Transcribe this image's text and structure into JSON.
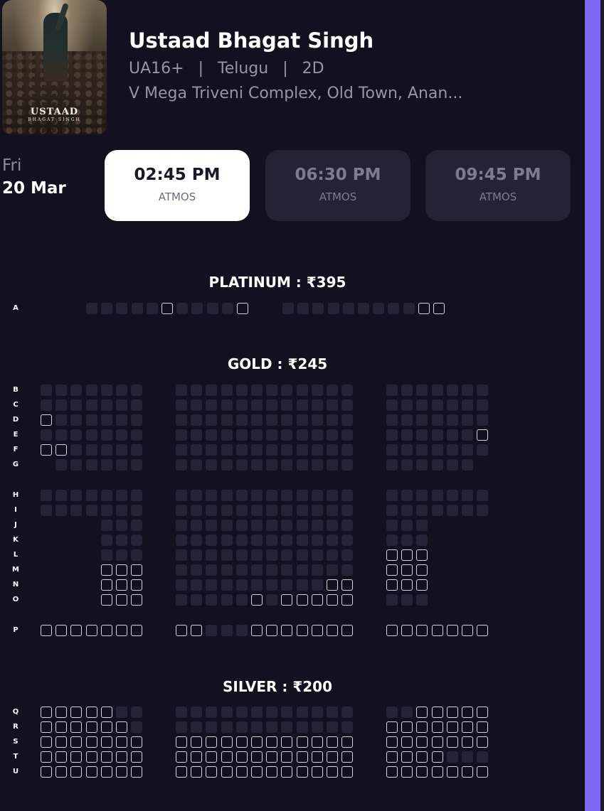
{
  "movie": {
    "title": "Ustaad Bhagat Singh",
    "certificate": "UA16+",
    "language": "Telugu",
    "format": "2D",
    "venue": "V Mega Triveni Complex, Old Town, Anan...",
    "poster_title": "USTAAD",
    "poster_subtitle": "BHAGAT SINGH"
  },
  "date": {
    "day": "Fri",
    "date": "20 Mar"
  },
  "showtimes": [
    {
      "time": "02:45 PM",
      "format": "ATMOS",
      "selected": true
    },
    {
      "time": "06:30 PM",
      "format": "ATMOS",
      "selected": false
    },
    {
      "time": "09:45 PM",
      "format": "ATMOS",
      "selected": false
    }
  ],
  "categories": [
    {
      "name": "PLATINUM : ₹395"
    },
    {
      "name": "GOLD : ₹245"
    },
    {
      "name": "SILVER : ₹200"
    }
  ],
  "seat_status_legend": {
    "A": "available",
    "S": "sold",
    "-": "no seat"
  },
  "seat_rows": [
    {
      "label": "A",
      "left": "",
      "mid": "SSSSSASSSSA",
      "right": "SSSSSSSSSAA",
      "layout": "platinum"
    },
    {
      "label": "B",
      "left": "SSSSSSS",
      "mid": "SSSSSSSSSSSS",
      "right": "SSSSSSS"
    },
    {
      "label": "C",
      "left": "SSSSSSS",
      "mid": "SSSSSSSSSSSS",
      "right": "SSSSSSS"
    },
    {
      "label": "D",
      "left": "ASSSSSS",
      "mid": "SSSSSSSSSSSS",
      "right": "SSSSSSS"
    },
    {
      "label": "E",
      "left": "SSSSSSS",
      "mid": "SSSSSSSSSSSS",
      "right": "SSSSSSA"
    },
    {
      "label": "F",
      "left": "AASSSSS",
      "mid": "SSSSSSSSSSSS",
      "right": "SSSSSSS"
    },
    {
      "label": "G",
      "left": "-SSSSSS",
      "mid": "SSSSSSSSSSSS",
      "right": "SSSSSS-"
    },
    {
      "label": "H",
      "left": "SSSSSSS",
      "mid": "SSSSSSSSSSSS",
      "right": "SSSSSSS"
    },
    {
      "label": "I",
      "left": "SSSSSSS",
      "mid": "SSSSSSSSSSSS",
      "right": "SSSSSSS"
    },
    {
      "label": "J",
      "left": "----SSS",
      "mid": "SSSSSSSSSSSS",
      "right": "SSS----"
    },
    {
      "label": "K",
      "left": "----SSS",
      "mid": "SSSSSSSSSSSS",
      "right": "SSS----"
    },
    {
      "label": "L",
      "left": "----SSS",
      "mid": "SSSSSSSSSSSS",
      "right": "AAA----"
    },
    {
      "label": "M",
      "left": "----AAA",
      "mid": "SSSSSSSSSSSS",
      "right": "AAA----"
    },
    {
      "label": "N",
      "left": "----AAA",
      "mid": "SSSSSSSSSSAA",
      "right": "AAA----"
    },
    {
      "label": "O",
      "left": "----AAA",
      "mid": "SSSSSASAAAAA",
      "right": "SSS----"
    },
    {
      "label": "P",
      "left": "AAAAAAA",
      "mid": "AASSSAAAAAAA",
      "right": "AAAAAAA"
    },
    {
      "label": "Q",
      "left": "AAAAASS",
      "mid": "SSSSSSSSSSSS",
      "right": "SSAAAAA"
    },
    {
      "label": "R",
      "left": "AAAAAAS",
      "mid": "SSSSSSSSSSSS",
      "right": "AAAAAAA"
    },
    {
      "label": "S",
      "left": "AAAAAAA",
      "mid": "AAAAAAAAAAAA",
      "right": "AAAAAAA"
    },
    {
      "label": "T",
      "left": "AAAAAAA",
      "mid": "AAAAAAAAAAAA",
      "right": "AAAASSS"
    },
    {
      "label": "U",
      "left": "AAAAAAA",
      "mid": "AAAAAAAAAAAA",
      "right": "AAAAAAA"
    }
  ],
  "colors": {
    "background": "#13111f",
    "sold_seat": "#252335",
    "available_seat_border": "#d6d5df",
    "accent_scrollbar": "#7f66f5"
  }
}
